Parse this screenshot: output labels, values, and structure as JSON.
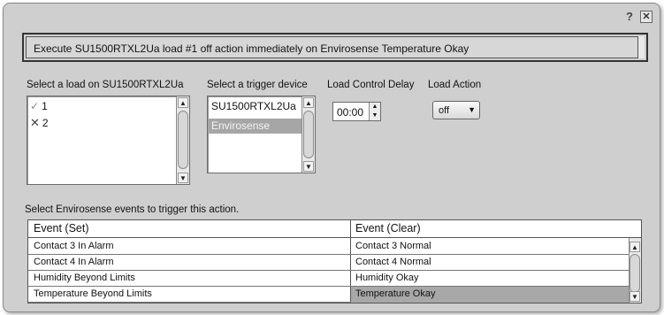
{
  "summary": "Execute SU1500RTXL2Ua load #1 off action immediately on Envirosense Temperature Okay",
  "title_controls": {
    "help": "?",
    "close": "✕"
  },
  "load_panel": {
    "label": "Select a load on SU1500RTXL2Ua",
    "items": [
      {
        "label": "1",
        "icon": "checkmark-icon"
      },
      {
        "label": "2",
        "icon": "x-icon"
      }
    ]
  },
  "trigger_panel": {
    "label": "Select a trigger device",
    "items": [
      "SU1500RTXL2Ua",
      "Envirosense"
    ],
    "selected": "Envirosense"
  },
  "delay": {
    "label": "Load Control Delay",
    "value": "00:00"
  },
  "action": {
    "label": "Load Action",
    "value": "off"
  },
  "events": {
    "label": "Select Envirosense events to trigger this action.",
    "headers": [
      "Event (Set)",
      "Event (Clear)"
    ],
    "rows": [
      [
        "Contact 3 In Alarm",
        "Contact 3 Normal"
      ],
      [
        "Contact 4 In Alarm",
        "Contact 4 Normal"
      ],
      [
        "Humidity Beyond Limits",
        "Humidity Okay"
      ],
      [
        "Temperature Beyond Limits",
        "Temperature Okay"
      ]
    ],
    "selected_cell": "Temperature Okay"
  },
  "colors": {
    "dialog_bg": "#cfcfcf",
    "selection": "#a6a6a6"
  }
}
